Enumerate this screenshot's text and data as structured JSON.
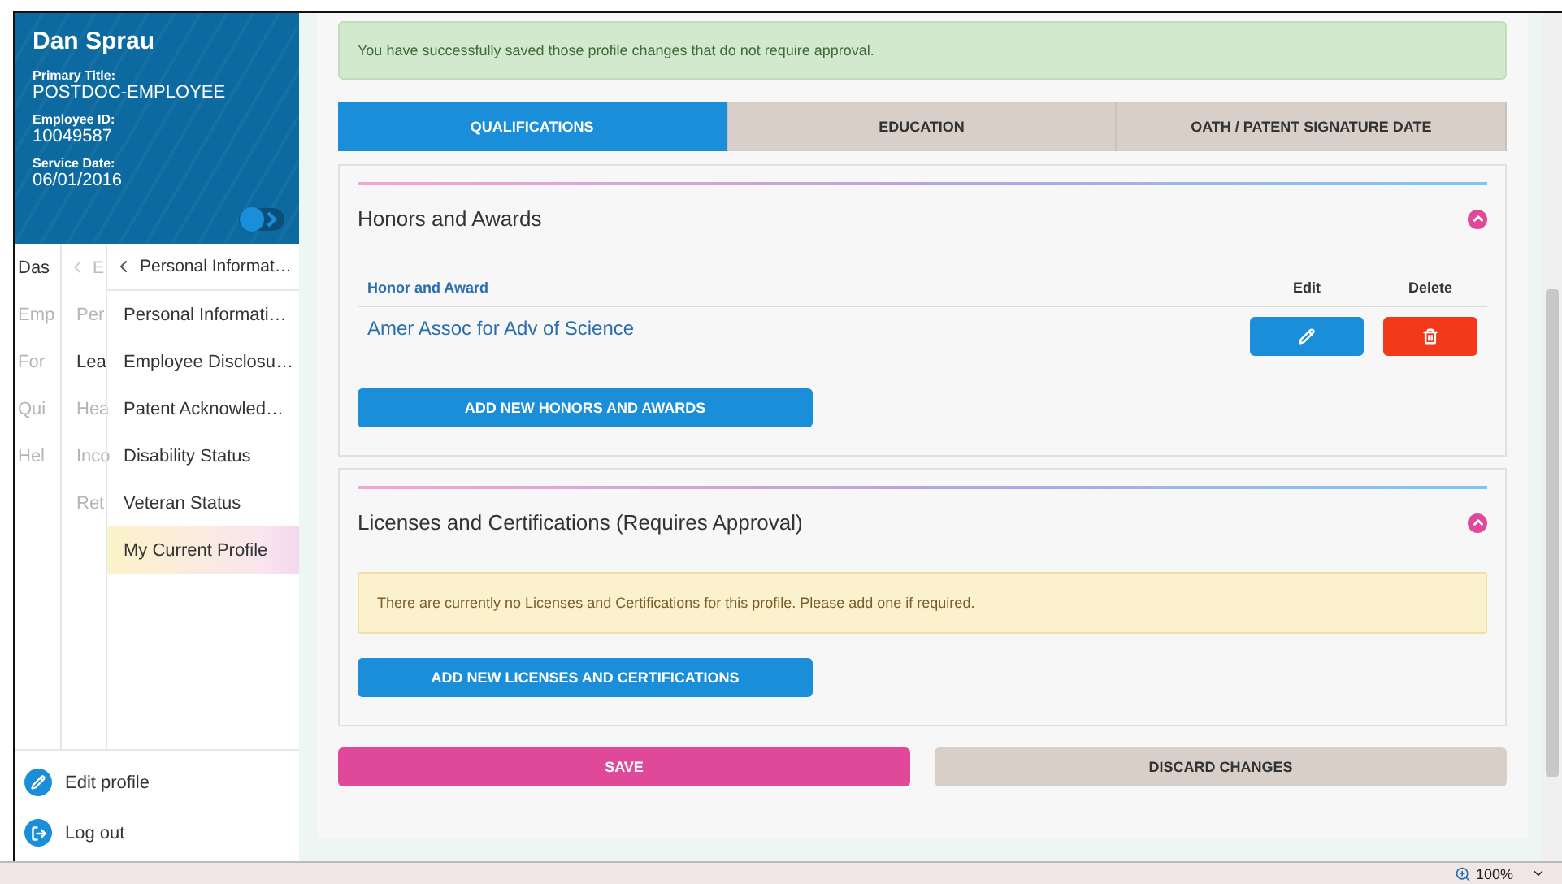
{
  "profile": {
    "name": "Dan Sprau",
    "fields": [
      {
        "label": "Primary Title:",
        "value": "POSTDOC-EMPLOYEE"
      },
      {
        "label": "Employee ID:",
        "value": "10049587"
      },
      {
        "label": "Service Date:",
        "value": "06/01/2016"
      }
    ]
  },
  "nav": {
    "column_1": [
      {
        "label": "Das",
        "dimmed": false
      },
      {
        "label": "Emp",
        "dimmed": true
      },
      {
        "label": "For",
        "dimmed": true
      },
      {
        "label": "Qui",
        "dimmed": true
      },
      {
        "label": "Hel",
        "dimmed": true
      }
    ],
    "column_2": {
      "header": "E",
      "items": [
        {
          "label": "Per",
          "dimmed": true
        },
        {
          "label": "Lea",
          "dimmed": false
        },
        {
          "label": "Hea",
          "dimmed": true
        },
        {
          "label": "Inco",
          "dimmed": true
        },
        {
          "label": "Ret",
          "dimmed": true
        }
      ]
    },
    "column_3": {
      "header": "Personal Informat…",
      "items": [
        {
          "label": "Personal Informati…",
          "selected": false
        },
        {
          "label": "Employee Disclosu…",
          "selected": false
        },
        {
          "label": "Patent Acknowled…",
          "selected": false
        },
        {
          "label": "Disability Status",
          "selected": false
        },
        {
          "label": "Veteran Status",
          "selected": false
        },
        {
          "label": "My Current Profile",
          "selected": true
        }
      ]
    }
  },
  "footer_links": [
    {
      "label": "Edit profile",
      "kind": "edit"
    },
    {
      "label": "Log out",
      "kind": "logout"
    }
  ],
  "alert": "You have successfully saved those profile changes that do not require approval.",
  "tabs": [
    {
      "label": "QUALIFICATIONS",
      "selected": true
    },
    {
      "label": "EDUCATION",
      "selected": false
    },
    {
      "label": "OATH / PATENT SIGNATURE DATE",
      "selected": false
    }
  ],
  "sections": [
    {
      "title": "Honors and Awards",
      "kind": "table",
      "columns": [
        "Honor and Award",
        "Edit",
        "Delete"
      ],
      "rows": [
        {
          "name": "Amer Assoc for Adv of Science"
        }
      ],
      "add_button": "ADD NEW HONORS AND AWARDS"
    },
    {
      "title": "Licenses and Certifications (Requires Approval)",
      "kind": "empty",
      "notice": "There are currently no Licenses and Certifications for this profile.  Please add one if required.",
      "add_button": "ADD NEW LICENSES AND CERTIFICATIONS"
    }
  ],
  "actions": [
    {
      "label": "SAVE",
      "kind": "primary"
    },
    {
      "label": "DISCARD CHANGES",
      "kind": "secondary"
    }
  ],
  "status_bar": {
    "zoom": "100%"
  }
}
